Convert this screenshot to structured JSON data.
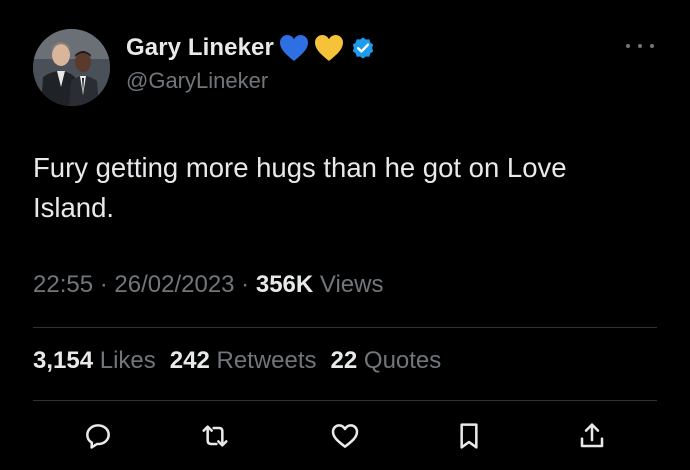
{
  "author": {
    "display_name": "Gary Lineker",
    "handle": "@GaryLineker",
    "emoji_1": "blue-heart-icon",
    "emoji_2": "yellow-heart-icon",
    "verified": "verified-badge-icon"
  },
  "tweet": {
    "text": "Fury getting more hugs than he got on Love Island."
  },
  "meta": {
    "time": "22:55",
    "separator_1": " · ",
    "date": "26/02/2023",
    "separator_2": " · ",
    "views_count": "356K",
    "views_label": " Views"
  },
  "stats": {
    "likes_count": "3,154",
    "likes_label": " Likes",
    "retweets_count": "242",
    "retweets_label": " Retweets",
    "quotes_count": "22",
    "quotes_label": " Quotes"
  },
  "actions": [
    "reply-icon",
    "retweet-icon",
    "like-icon",
    "bookmark-icon",
    "share-icon"
  ],
  "colors": {
    "background": "#000000",
    "text_primary": "#e7e9ea",
    "text_secondary": "#71767b",
    "divider": "#2f3336",
    "verified_blue": "#1d9bf0",
    "heart_blue": "#2f6fe4",
    "heart_yellow": "#f5c23a"
  }
}
